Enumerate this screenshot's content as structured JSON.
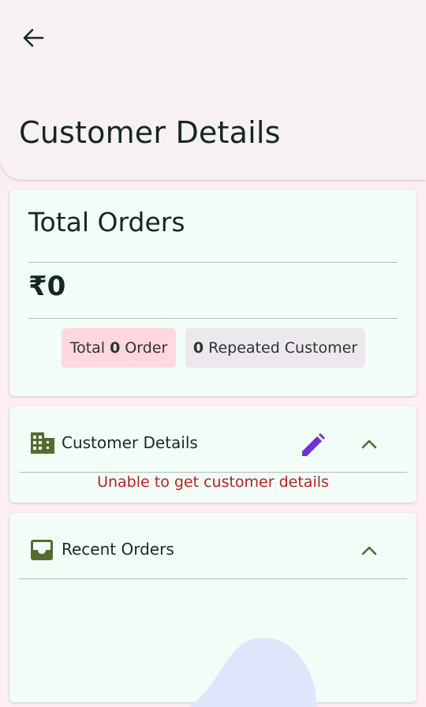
{
  "appbar": {
    "title": "Customer Details",
    "back_icon": "arrow-back-icon"
  },
  "summary": {
    "title": "Total Orders",
    "amount": "₹0",
    "chips": {
      "orders_prefix": "Total",
      "orders_count": "0",
      "orders_suffix": "Order",
      "repeat_count": "0",
      "repeat_label": "Repeated Customer"
    }
  },
  "customer_section": {
    "label": "Customer Details",
    "icon": "building-icon",
    "edit_icon": "pencil-icon",
    "error": "Unable to get customer details"
  },
  "orders_section": {
    "label": "Recent Orders",
    "icon": "inbox-icon"
  },
  "colors": {
    "appbar_bg": "#f8f1f3",
    "card_bg": "#f2fdf8",
    "chip_orders_bg": "#ffd7df",
    "chip_repeat_bg": "#ede8ee",
    "icon_olive": "#556b2f",
    "edit_purple": "#6e32d6",
    "error_red": "#b3261e"
  }
}
